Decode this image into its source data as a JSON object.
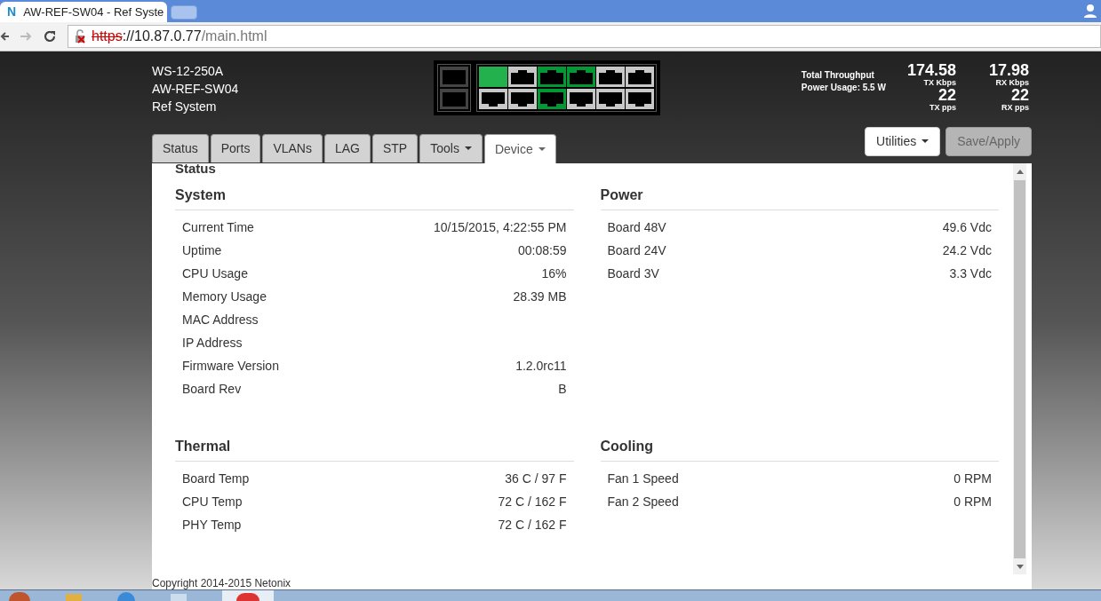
{
  "browser": {
    "favicon": "N",
    "tab_title": "AW-REF-SW04 - Ref Syste",
    "url_scheme": "https",
    "url_host": "://10.87.0.77",
    "url_path": "/main.html"
  },
  "device": {
    "lines": [
      "WS-12-250A",
      "AW-REF-SW04",
      "Ref System"
    ]
  },
  "sfp_ports": [
    {
      "link": false
    },
    {
      "link": false
    }
  ],
  "ports_top": [
    {
      "link": true,
      "selected": true
    },
    {
      "link": false,
      "selected": false
    },
    {
      "link": true,
      "selected": false
    },
    {
      "link": true,
      "selected": false
    },
    {
      "link": false,
      "selected": false
    },
    {
      "link": false,
      "selected": false
    }
  ],
  "ports_bottom": [
    {
      "link": false,
      "selected": false
    },
    {
      "link": false,
      "selected": false
    },
    {
      "link": true,
      "selected": false
    },
    {
      "link": false,
      "selected": false
    },
    {
      "link": false,
      "selected": false
    },
    {
      "link": false,
      "selected": false
    }
  ],
  "throughput": {
    "title": "Total Throughput",
    "power": "Power Usage: 5.5 W",
    "stats": [
      {
        "value": "174.58",
        "unit": "TX Kbps"
      },
      {
        "value": "17.98",
        "unit": "RX Kbps"
      },
      {
        "value": "22",
        "unit": "TX pps"
      },
      {
        "value": "22",
        "unit": "RX pps"
      }
    ]
  },
  "tabs": [
    {
      "label": "Status",
      "selected": false,
      "dropdown": false
    },
    {
      "label": "Ports",
      "selected": false,
      "dropdown": false
    },
    {
      "label": "VLANs",
      "selected": false,
      "dropdown": false
    },
    {
      "label": "LAG",
      "selected": false,
      "dropdown": false
    },
    {
      "label": "STP",
      "selected": false,
      "dropdown": false
    },
    {
      "label": "Tools",
      "selected": false,
      "dropdown": true
    },
    {
      "label": "Device",
      "selected": true,
      "dropdown": true
    }
  ],
  "buttons": [
    {
      "label": "Utilities",
      "kind": "dropdown",
      "disabled": false
    },
    {
      "label": "Save/Apply",
      "kind": "plain",
      "disabled": true
    }
  ],
  "page_title": "Status",
  "sections": [
    {
      "title": "System",
      "rows": [
        {
          "label": "Current Time",
          "value": "10/15/2015, 4:22:55 PM"
        },
        {
          "label": "Uptime",
          "value": "00:08:59"
        },
        {
          "label": "CPU Usage",
          "value": "16%"
        },
        {
          "label": "Memory Usage",
          "value": "28.39 MB"
        },
        {
          "label": "MAC Address"
        },
        {
          "label": "IP Address"
        },
        {
          "label": "Firmware Version",
          "value": "1.2.0rc11"
        },
        {
          "label": "Board Rev",
          "value": "B"
        }
      ]
    },
    {
      "title": "Power",
      "rows": [
        {
          "label": "Board 48V",
          "value": "49.6 Vdc"
        },
        {
          "label": "Board 24V",
          "value": "24.2 Vdc"
        },
        {
          "label": "Board 3V",
          "value": "3.3 Vdc"
        }
      ]
    },
    {
      "title": "Thermal",
      "rows": [
        {
          "label": "Board Temp",
          "value": "36 C / 97 F"
        },
        {
          "label": "CPU Temp",
          "value": "72 C / 162 F"
        },
        {
          "label": "PHY Temp",
          "value": "72 C / 162 F"
        }
      ]
    },
    {
      "title": "Cooling",
      "rows": [
        {
          "label": "Fan 1 Speed",
          "value": "0 RPM"
        },
        {
          "label": "Fan 2 Speed",
          "value": "0 RPM"
        }
      ]
    }
  ],
  "footer": "Copyright 2014-2015 Netonix"
}
